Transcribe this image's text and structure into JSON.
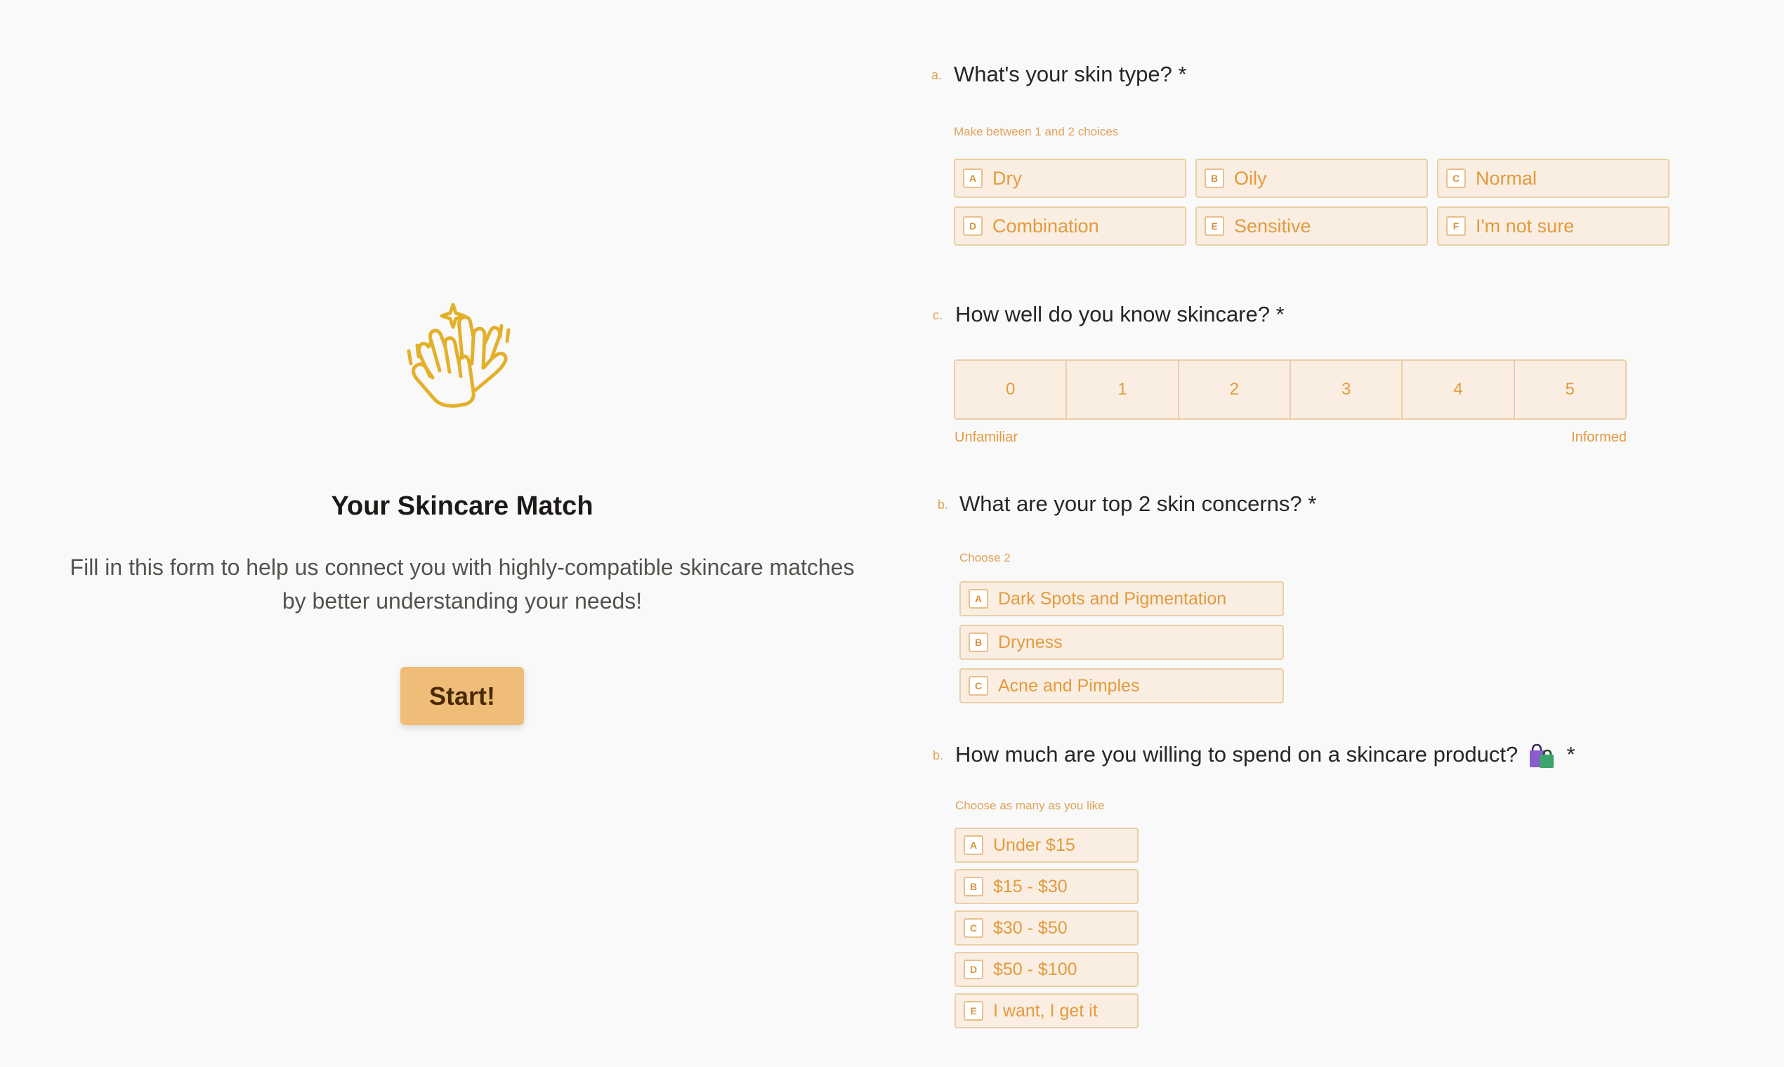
{
  "welcome": {
    "title": "Your Skincare Match",
    "description": "Fill in this form to help us connect you with highly-compatible skincare matches by better understanding your needs!",
    "start_button": "Start!"
  },
  "questions": {
    "skin_type": {
      "index": "a.",
      "title": "What's your skin type? *",
      "help": "Make between 1 and 2 choices",
      "choices": [
        {
          "key": "A",
          "label": "Dry"
        },
        {
          "key": "B",
          "label": "Oily"
        },
        {
          "key": "C",
          "label": "Normal"
        },
        {
          "key": "D",
          "label": "Combination"
        },
        {
          "key": "E",
          "label": "Sensitive"
        },
        {
          "key": "F",
          "label": "I'm not sure"
        }
      ]
    },
    "knowledge": {
      "index": "c.",
      "title": "How well do you know skincare? *",
      "scale": [
        "0",
        "1",
        "2",
        "3",
        "4",
        "5"
      ],
      "left_label": "Unfamiliar",
      "right_label": "Informed"
    },
    "concerns": {
      "index": "b.",
      "title": "What are your top 2 skin concerns? *",
      "help": "Choose 2",
      "choices": [
        {
          "key": "A",
          "label": "Dark Spots and Pigmentation"
        },
        {
          "key": "B",
          "label": "Dryness"
        },
        {
          "key": "C",
          "label": "Acne and Pimples"
        }
      ]
    },
    "budget": {
      "index": "b.",
      "title_prefix": "How much are you willing to spend on a skincare product?",
      "title_suffix": "*",
      "help": "Choose as many as you like",
      "choices": [
        {
          "key": "A",
          "label": "Under $15"
        },
        {
          "key": "B",
          "label": "$15 - $30"
        },
        {
          "key": "C",
          "label": "$30 - $50"
        },
        {
          "key": "D",
          "label": "$50 - $100"
        },
        {
          "key": "E",
          "label": "I want, I get it"
        }
      ]
    }
  },
  "icons": {
    "welcome": "high-five-hands-icon",
    "budget": "shopping-bags-icon"
  },
  "colors": {
    "accent": "#f0bd79",
    "choice_text": "#e39a3f",
    "choice_bg": "#f9eee1",
    "choice_border": "#eacfa6",
    "background": "#f9f9f9"
  }
}
